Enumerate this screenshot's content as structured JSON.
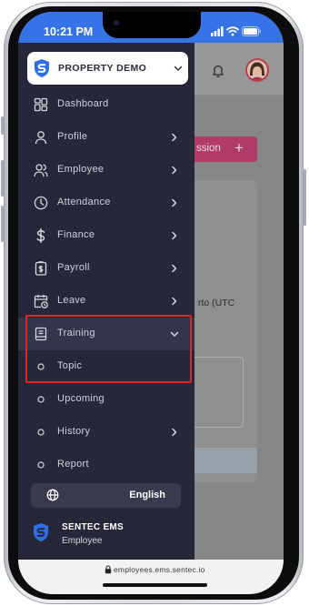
{
  "colors": {
    "status_bar": "#3673e6",
    "sidebar": "#27273a",
    "sidebar_active": "#34344a",
    "brand_blue": "#2f6fe6",
    "accent_button": "#b03a68",
    "highlight_box": "#e02424"
  },
  "status_bar": {
    "time": "10:21 PM",
    "icons": [
      "signal-icon",
      "wifi-icon",
      "battery-icon"
    ]
  },
  "page_behind": {
    "header_icons": [
      "bell-icon",
      "avatar"
    ],
    "button_text": "ssion",
    "button_icon": "+",
    "timezone_text": "rto (UTC"
  },
  "sidebar": {
    "property_selector": {
      "label": "PROPERTY DEMO",
      "icon": "shield-logo-icon",
      "expanded": false
    },
    "items": [
      {
        "label": "Dashboard",
        "icon": "dashboard-icon"
      },
      {
        "label": "Profile",
        "icon": "user-icon",
        "chevron": "right"
      },
      {
        "label": "Employee",
        "icon": "users-icon",
        "chevron": "right"
      },
      {
        "label": "Attendance",
        "icon": "clock-icon",
        "chevron": "right"
      },
      {
        "label": "Finance",
        "icon": "dollar-icon",
        "chevron": "right"
      },
      {
        "label": "Payroll",
        "icon": "payroll-icon",
        "chevron": "right"
      },
      {
        "label": "Leave",
        "icon": "calendar-icon",
        "chevron": "right"
      },
      {
        "label": "Training",
        "icon": "book-icon",
        "chevron": "down",
        "expanded": true,
        "active": true
      }
    ],
    "training_subitems": [
      {
        "label": "Topic",
        "icon": "circle-bullet-icon"
      },
      {
        "label": "Upcoming",
        "icon": "circle-bullet-icon"
      },
      {
        "label": "History",
        "icon": "circle-bullet-icon",
        "chevron": "right"
      },
      {
        "label": "Report",
        "icon": "circle-bullet-icon"
      }
    ],
    "language": {
      "label": "English",
      "icon": "globe-icon"
    },
    "footer": {
      "brand": "SENTEC EMS",
      "role": "Employee",
      "icon": "sentec-logo-icon"
    }
  },
  "browser": {
    "url": "employees.ems.sentec.io",
    "icon": "lock-icon"
  },
  "annotation": {
    "highlighted_items": [
      "Training",
      "Topic"
    ]
  }
}
